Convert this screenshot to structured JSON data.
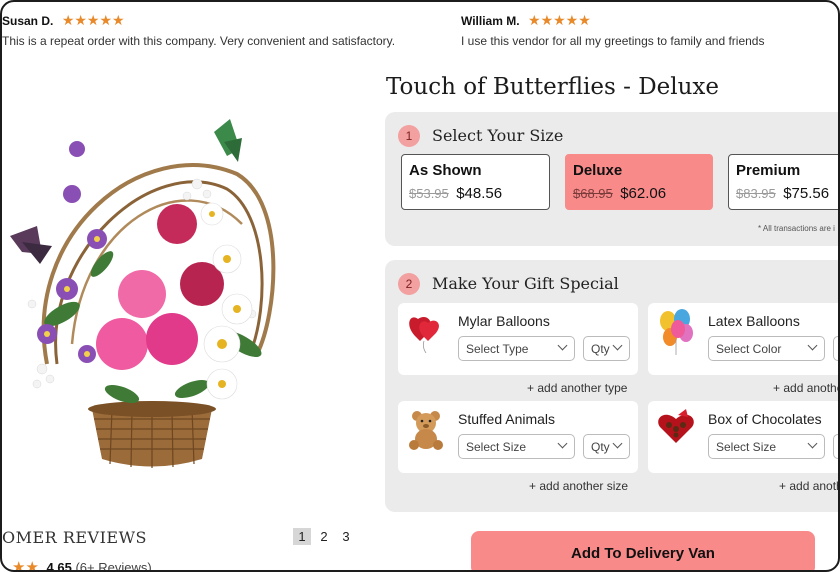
{
  "reviews_top": [
    {
      "name": "Susan D.",
      "stars": "★★★★★",
      "text": "This is a repeat order with this company. Very convenient and satisfactory."
    },
    {
      "name": "William M.",
      "stars": "★★★★★",
      "text": "I use this vendor for all my greetings to family and friends"
    }
  ],
  "product": {
    "title": "Touch of Butterflies - Deluxe"
  },
  "size_step": {
    "number": "1",
    "title": "Select Your Size",
    "options": [
      {
        "name": "As Shown",
        "old_price": "$53.95",
        "price": "$48.56",
        "selected": false
      },
      {
        "name": "Deluxe",
        "old_price": "$68.95",
        "price": "$62.06",
        "selected": true
      },
      {
        "name": "Premium",
        "old_price": "$83.95",
        "price": "$75.56",
        "selected": false
      }
    ],
    "note": "* All transactions are i"
  },
  "gift_step": {
    "number": "2",
    "title": "Make Your Gift Special",
    "addons": [
      {
        "title": "Mylar Balloons",
        "select_label": "Select Type",
        "qty_label": "Qty",
        "add_link": "+ add another type",
        "icon": "mylar-balloon-icon"
      },
      {
        "title": "Latex Balloons",
        "select_label": "Select Color",
        "qty_label": "",
        "add_link": "+ add anothe",
        "icon": "latex-balloons-icon"
      },
      {
        "title": "Stuffed Animals",
        "select_label": "Select Size",
        "qty_label": "Qty",
        "add_link": "+ add another size",
        "icon": "teddy-bear-icon"
      },
      {
        "title": "Box of Chocolates",
        "select_label": "Select Size",
        "qty_label": "",
        "add_link": "+ add anoth",
        "icon": "chocolate-box-icon"
      }
    ]
  },
  "customer_reviews": {
    "heading": "OMER REVIEWS",
    "rating": "4.65",
    "count": "(6+ Reviews)",
    "stars": "★★",
    "pages": [
      "1",
      "2",
      "3"
    ],
    "active_page": "1"
  },
  "cta": {
    "label": "Add To Delivery Van"
  },
  "colors": {
    "accent": "#f88a8a",
    "star": "#e8892a",
    "panel": "#ebebeb"
  }
}
